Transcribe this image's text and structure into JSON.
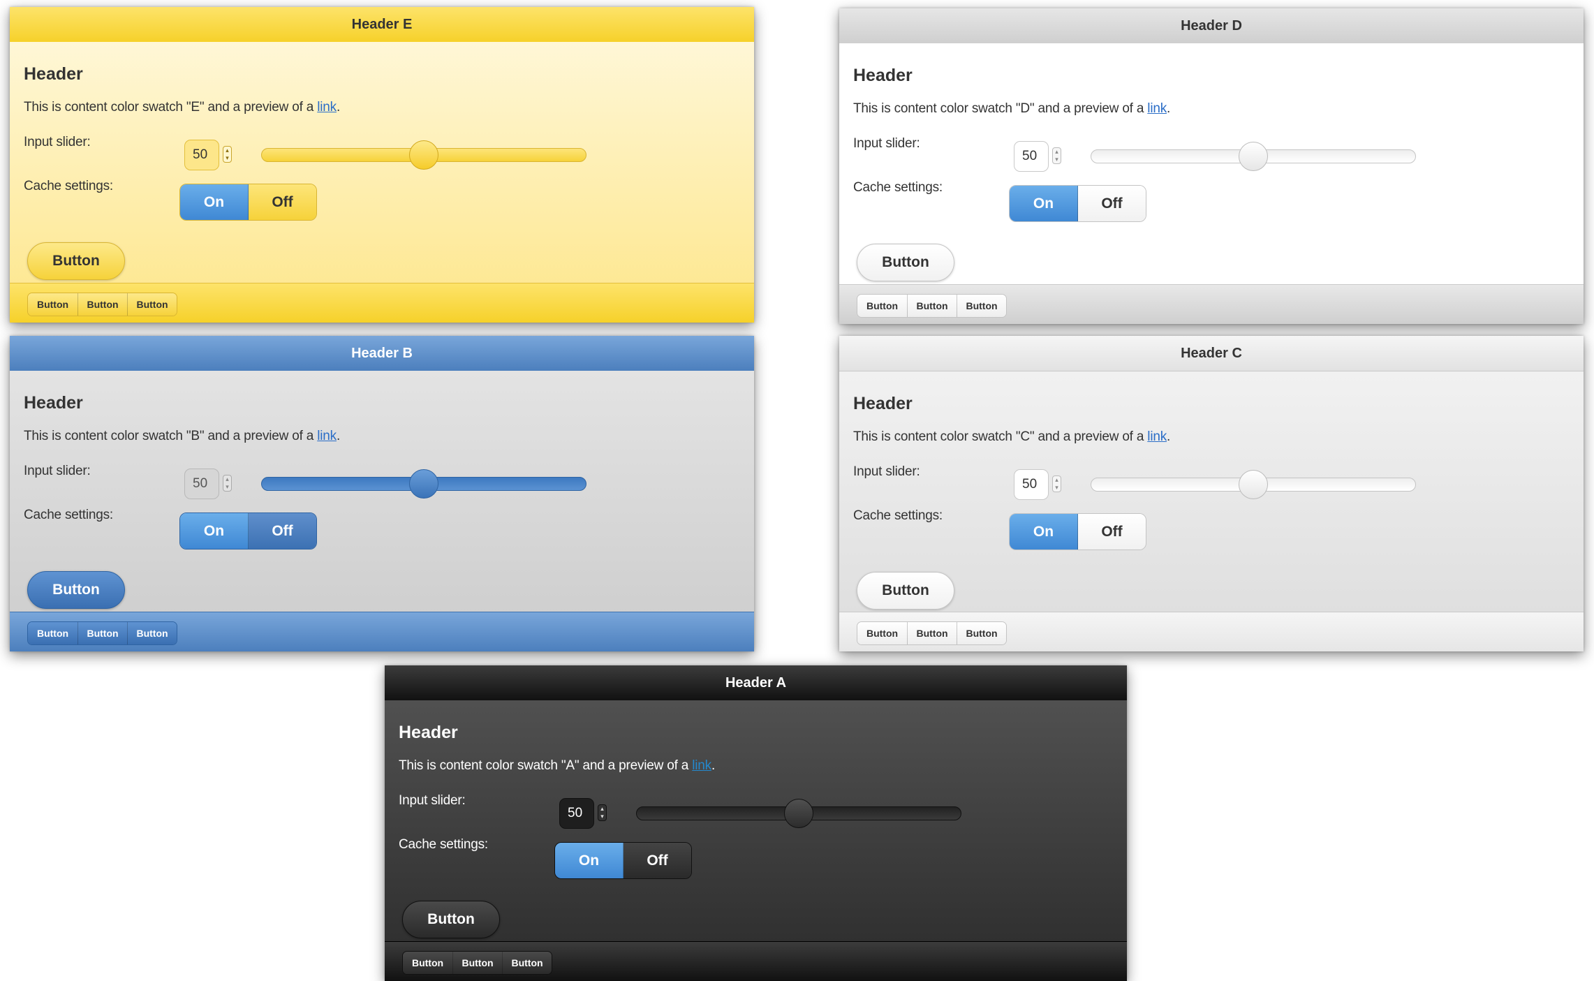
{
  "swatches": [
    {
      "id": "e",
      "header": "Header E",
      "content_title": "Header",
      "desc_before": "This is content color swatch \"E\" and a preview of a ",
      "link_text": "link",
      "desc_after": ".",
      "slider_label": "Input slider:",
      "slider_value": "50",
      "slider_fraction": 0.5,
      "cache_label": "Cache settings:",
      "toggle_on": "On",
      "toggle_off": "Off",
      "button_label": "Button",
      "footer_buttons": [
        "Button",
        "Button",
        "Button"
      ]
    },
    {
      "id": "d",
      "header": "Header D",
      "content_title": "Header",
      "desc_before": "This is content color swatch \"D\" and a preview of a ",
      "link_text": "link",
      "desc_after": ".",
      "slider_label": "Input slider:",
      "slider_value": "50",
      "slider_fraction": 0.5,
      "cache_label": "Cache settings:",
      "toggle_on": "On",
      "toggle_off": "Off",
      "button_label": "Button",
      "footer_buttons": [
        "Button",
        "Button",
        "Button"
      ]
    },
    {
      "id": "b",
      "header": "Header B",
      "content_title": "Header",
      "desc_before": "This is content color swatch \"B\" and a preview of a ",
      "link_text": "link",
      "desc_after": ".",
      "slider_label": "Input slider:",
      "slider_value": "50",
      "slider_fraction": 0.5,
      "cache_label": "Cache settings:",
      "toggle_on": "On",
      "toggle_off": "Off",
      "button_label": "Button",
      "footer_buttons": [
        "Button",
        "Button",
        "Button"
      ]
    },
    {
      "id": "c",
      "header": "Header C",
      "content_title": "Header",
      "desc_before": "This is content color swatch \"C\" and a preview of a ",
      "link_text": "link",
      "desc_after": ".",
      "slider_label": "Input slider:",
      "slider_value": "50",
      "slider_fraction": 0.5,
      "cache_label": "Cache settings:",
      "toggle_on": "On",
      "toggle_off": "Off",
      "button_label": "Button",
      "footer_buttons": [
        "Button",
        "Button",
        "Button"
      ]
    },
    {
      "id": "a",
      "header": "Header A",
      "content_title": "Header",
      "desc_before": "This is content color swatch \"A\" and a preview of a ",
      "link_text": "link",
      "desc_after": ".",
      "slider_label": "Input slider:",
      "slider_value": "50",
      "slider_fraction": 0.5,
      "cache_label": "Cache settings:",
      "toggle_on": "On",
      "toggle_off": "Off",
      "button_label": "Button",
      "footer_buttons": [
        "Button",
        "Button",
        "Button"
      ]
    }
  ],
  "colors": {
    "accent_on": "#4a90d9",
    "swatch_e": "#f6d12a",
    "swatch_d": "#ffffff",
    "swatch_b": "#4c7fbd",
    "swatch_c": "#e6e6e6",
    "swatch_a": "#2b2b2b",
    "link": "#2a6dc7"
  },
  "icons": {
    "spinner": "stepper-arrows-icon"
  }
}
